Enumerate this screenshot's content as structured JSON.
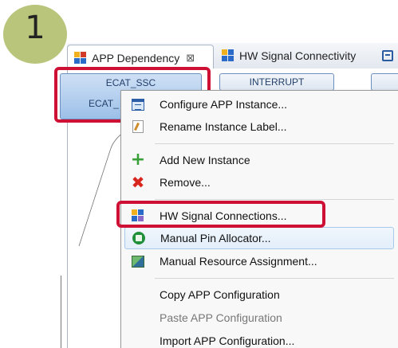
{
  "step_badge": {
    "number": "1"
  },
  "tabs": [
    {
      "label": "APP Dependency",
      "icon": "app-dependency-icon",
      "close": "⊠"
    },
    {
      "label": "HW Signal Connectivity",
      "icon": "hw-signal-connectivity-icon"
    },
    {
      "icon": "view-icon"
    }
  ],
  "canvas": {
    "instances": [
      {
        "line1": "ECAT_SSC",
        "line2": "ECAT_"
      },
      {
        "label": "INTERRUPT"
      }
    ]
  },
  "context_menu": {
    "groups": [
      [
        {
          "label": "Configure APP Instance...",
          "icon": "configure-icon"
        },
        {
          "label": "Rename Instance Label...",
          "icon": "rename-icon"
        }
      ],
      [
        {
          "label": "Add New Instance",
          "icon": "add-icon"
        },
        {
          "label": "Remove...",
          "icon": "remove-icon"
        }
      ],
      [
        {
          "label": "HW Signal Connections...",
          "icon": "hw-signal-icon"
        },
        {
          "label": "Manual Pin Allocator...",
          "icon": "pin-allocator-icon",
          "hovered": true
        },
        {
          "label": "Manual Resource Assignment...",
          "icon": "resource-icon"
        }
      ],
      [
        {
          "label": "Copy APP Configuration"
        },
        {
          "label": "Paste APP Configuration",
          "disabled": true
        },
        {
          "label": "Import APP Configuration..."
        }
      ]
    ]
  },
  "colors": {
    "highlight": "#cf1035",
    "badge": "#b8c57a",
    "instance_selected": "#9cc0e8"
  }
}
